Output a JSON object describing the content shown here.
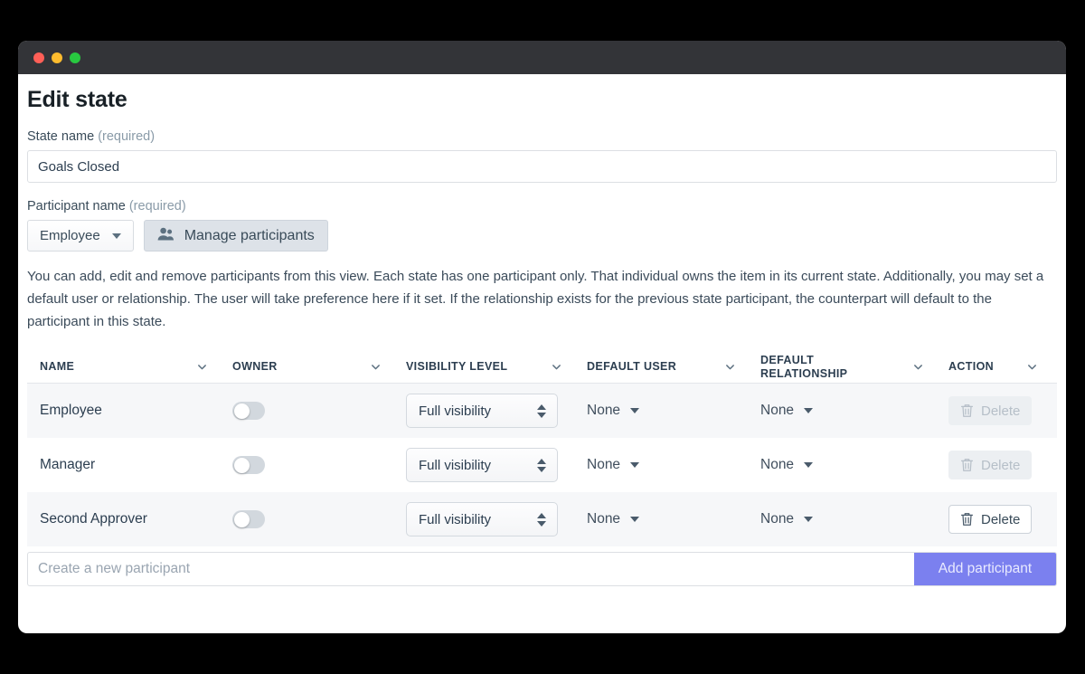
{
  "window": {
    "traffic_lights": [
      "close",
      "minimize",
      "maximize"
    ]
  },
  "page": {
    "title": "Edit state"
  },
  "state_name": {
    "label": "State name",
    "required_note": "(required)",
    "value": "Goals Closed",
    "placeholder": ""
  },
  "participant_name": {
    "label": "Participant name",
    "required_note": "(required)",
    "selected": "Employee",
    "manage_button": "Manage participants",
    "manage_icon": "users-icon"
  },
  "description": "You can add, edit and remove participants from this view. Each state has one participant only. That individual owns the item in its current state. Additionally, you may set a default user or relationship. The user will take preference here if it set. If the relationship exists for the previous state participant, the counterpart will default to the participant in this state.",
  "table": {
    "columns": [
      {
        "label": "NAME",
        "sort_icon": "chevron-down-icon"
      },
      {
        "label": "OWNER",
        "sort_icon": "chevron-down-icon"
      },
      {
        "label": "VISIBILITY LEVEL",
        "sort_icon": "chevron-down-icon"
      },
      {
        "label": "DEFAULT USER",
        "sort_icon": "chevron-down-icon"
      },
      {
        "label": "DEFAULT RELATIONSHIP",
        "sort_icon": "chevron-down-icon"
      },
      {
        "label": "ACTION",
        "sort_icon": "chevron-down-icon"
      }
    ],
    "rows": [
      {
        "name": "Employee",
        "owner_on": false,
        "visibility": "Full visibility",
        "default_user": "None",
        "default_relationship": "None",
        "action_label": "Delete",
        "action_enabled": false
      },
      {
        "name": "Manager",
        "owner_on": false,
        "visibility": "Full visibility",
        "default_user": "None",
        "default_relationship": "None",
        "action_label": "Delete",
        "action_enabled": false
      },
      {
        "name": "Second Approver",
        "owner_on": false,
        "visibility": "Full visibility",
        "default_user": "None",
        "default_relationship": "None",
        "action_label": "Delete",
        "action_enabled": true
      }
    ]
  },
  "add_bar": {
    "placeholder": "Create a new participant",
    "value": "",
    "button_label": "Add participant",
    "button_color": "#7b80ef"
  },
  "colors": {
    "titlebar": "#333438",
    "accent": "#7b80ef",
    "row_stripe": "#f6f7f9",
    "page_background": "#000000"
  }
}
